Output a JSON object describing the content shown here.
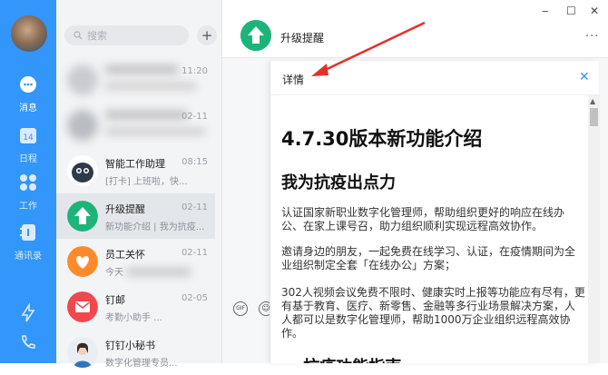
{
  "nav": {
    "items": [
      {
        "label": "消息",
        "icon": "chat-bubble-icon"
      },
      {
        "label": "日程",
        "icon": "calendar-icon",
        "badge": "14"
      },
      {
        "label": "工作",
        "icon": "apps-grid-icon"
      },
      {
        "label": "通讯录",
        "icon": "contacts-icon"
      }
    ],
    "bottom_icons": [
      "lightning-icon",
      "phone-callback-icon"
    ],
    "accent": "#3296fa"
  },
  "search": {
    "placeholder": "搜索"
  },
  "list": {
    "items": [
      {
        "name": "",
        "sub": "",
        "time": "11:20"
      },
      {
        "name": "",
        "sub": "",
        "time": "02-11"
      },
      {
        "name": "智能工作助理",
        "sub": "[打卡] 上班啦，快...",
        "time": "08:15"
      },
      {
        "name": "升级提醒",
        "sub": "新功能介绍 | 我为抗疫...",
        "time": "02-11"
      },
      {
        "name": "员工关怀",
        "sub": "今天",
        "time": "02-11"
      },
      {
        "name": "钉邮",
        "sub": "考勤小助手 ...",
        "time": "02-05"
      },
      {
        "name": "钉钉小秘书",
        "sub": "数字化管理专员...",
        "time": ""
      }
    ]
  },
  "chat": {
    "title": "升级提醒",
    "more": "···"
  },
  "window": {
    "minimize": "‒",
    "maximize": "☐",
    "close": "✕"
  },
  "composer": {
    "gif_label": "GIF"
  },
  "panel": {
    "label": "详情",
    "close": "✕",
    "heading": "4.7.30版本新功能介绍",
    "subheading": "我为抗疫出点力",
    "paragraphs": [
      "认证国家新职业数字化管理师，帮助组织更好的响应在线办公、在家上课号召，助力组织顺利实现远程高效协作。",
      "邀请身边的朋友，一起免费在线学习、认证，在疫情期间为全业组织制定全套「在线办公」方案；",
      "302人视频会议免费不限时、健康实时上报等功能应有尽有，更有基于教育、医疗、新零售、金融等多行业场景解决方案，人人都可以是数字化管理师，帮助1000万企业组织远程高效协作。"
    ],
    "cut_heading": "—    抗疫功能指南"
  }
}
